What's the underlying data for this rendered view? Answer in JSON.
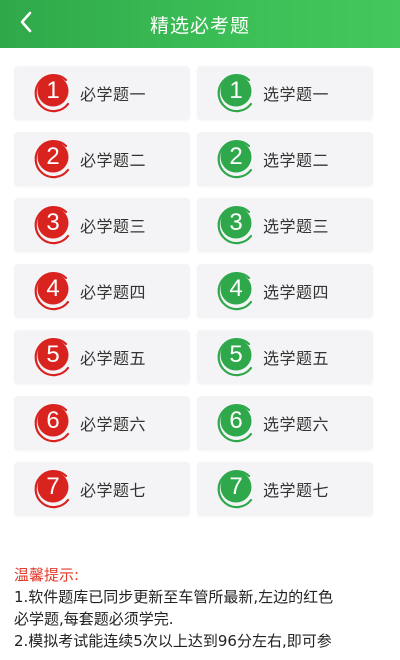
{
  "header": {
    "title": "精选必考题",
    "back_icon": "chevron-left-icon"
  },
  "colors": {
    "header": "#34b24f",
    "required": "#d9231f",
    "optional": "#2ea84a"
  },
  "required": [
    {
      "num": "1",
      "label": "必学题一"
    },
    {
      "num": "2",
      "label": "必学题二"
    },
    {
      "num": "3",
      "label": "必学题三"
    },
    {
      "num": "4",
      "label": "必学题四"
    },
    {
      "num": "5",
      "label": "必学题五"
    },
    {
      "num": "6",
      "label": "必学题六"
    },
    {
      "num": "7",
      "label": "必学题七"
    }
  ],
  "optional": [
    {
      "num": "1",
      "label": "选学题一"
    },
    {
      "num": "2",
      "label": "选学题二"
    },
    {
      "num": "3",
      "label": "选学题三"
    },
    {
      "num": "4",
      "label": "选学题四"
    },
    {
      "num": "5",
      "label": "选学题五"
    },
    {
      "num": "6",
      "label": "选学题六"
    },
    {
      "num": "7",
      "label": "选学题七"
    }
  ],
  "tips": {
    "title": "温馨提示:",
    "line1a": "1.软件题库已同步更新至车管所最新,左边的红色",
    "line1b": "必学题,每套题必须学完.",
    "line2": "2.模拟考试能连续5次以上达到96分左右,即可参"
  }
}
